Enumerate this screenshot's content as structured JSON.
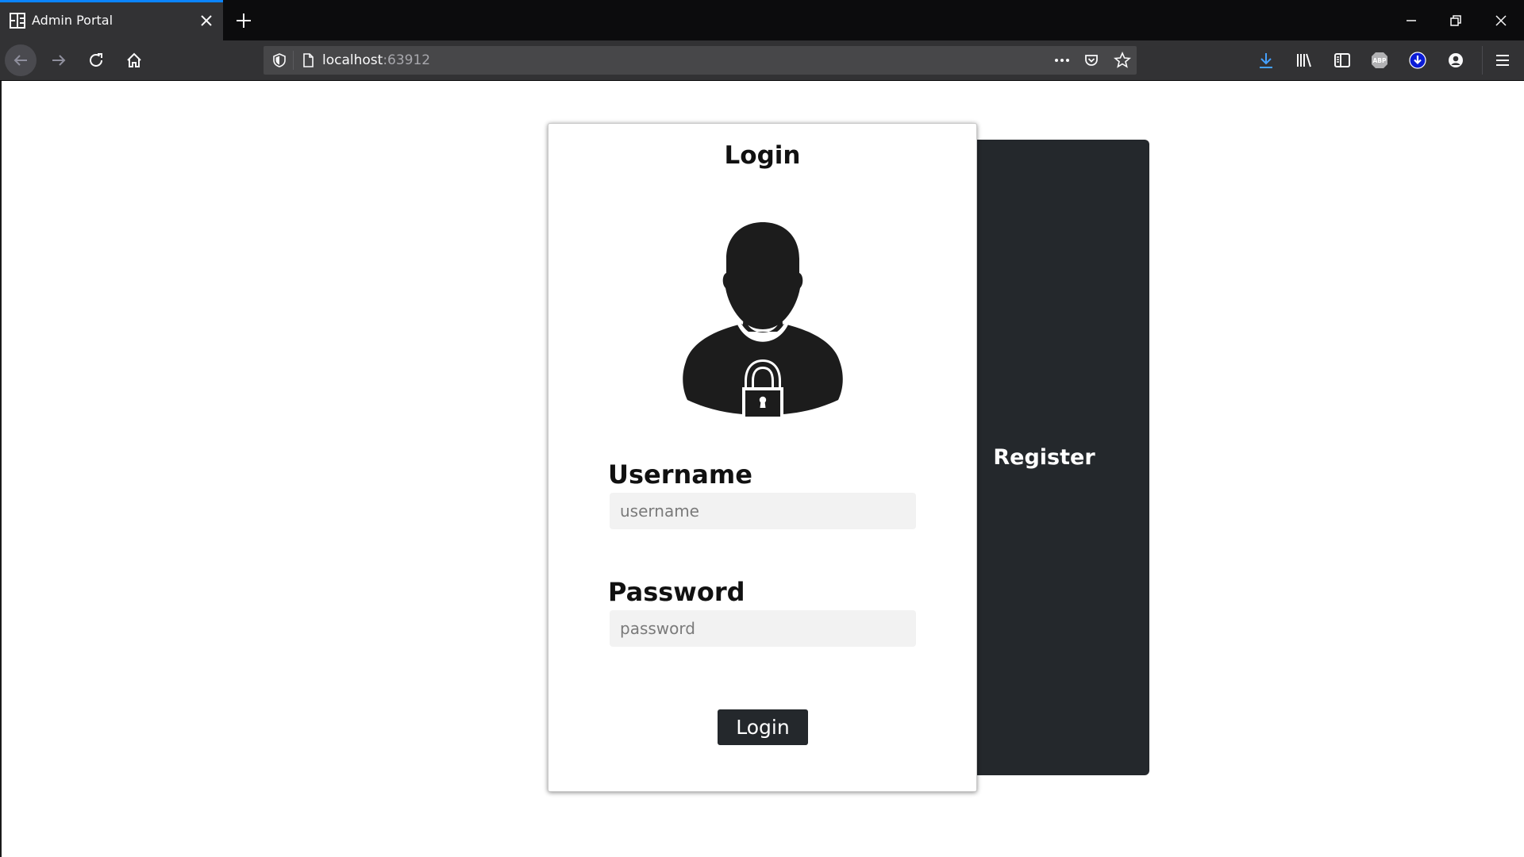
{
  "browser": {
    "tab_title": "Admin Portal",
    "url_host": "localhost",
    "url_port": ":63912"
  },
  "icons": {
    "tab_favicon": "grid-app-icon",
    "tab_close": "close-icon",
    "new_tab": "plus-icon",
    "minimize": "minimize-icon",
    "restore": "restore-icon",
    "close_window": "close-icon",
    "back": "arrow-left-icon",
    "forward": "arrow-right-icon",
    "reload": "reload-icon",
    "home": "home-icon",
    "tracking_protection": "shield-icon",
    "page_info": "page-icon",
    "page_actions": "ellipsis-icon",
    "pocket": "pocket-icon",
    "bookmark": "star-icon",
    "downloads": "download-icon",
    "library": "library-icon",
    "sidebars": "sidebar-icon",
    "adblock": "abp-icon",
    "download_extension": "download-circle-icon",
    "account": "account-icon",
    "menu": "hamburger-menu-icon",
    "avatar": "user-lock-icon"
  },
  "login": {
    "title": "Login",
    "username_label": "Username",
    "username_placeholder": "username",
    "password_label": "Password",
    "password_placeholder": "password",
    "submit_label": "Login"
  },
  "register": {
    "label": "Register"
  },
  "colors": {
    "panel_dark": "#24282c",
    "input_bg": "#f2f2f2",
    "tab_accent": "#0a84ff"
  }
}
